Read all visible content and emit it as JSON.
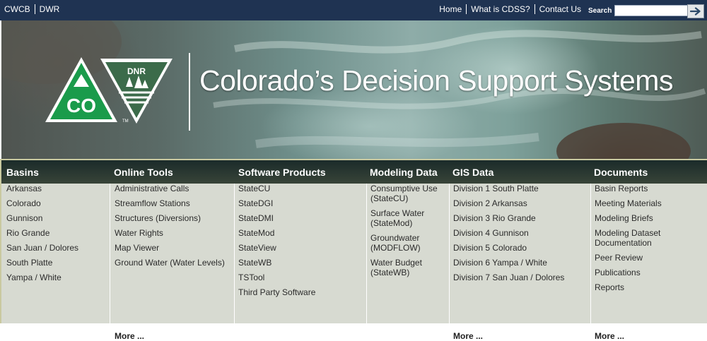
{
  "top_nav": {
    "left_links": [
      "CWCB",
      "DWR"
    ],
    "right_links": [
      "Home",
      "What is CDSS?",
      "Contact Us"
    ],
    "search_label": "Search",
    "search_value": ""
  },
  "banner": {
    "co_logo_text": "CO",
    "dnr_logo_text": "DNR",
    "tm_text": "TM",
    "title": "Colorado’s Decision Support Systems"
  },
  "menu": {
    "columns": [
      {
        "title": "Basins",
        "items": [
          "Arkansas",
          "Colorado",
          "Gunnison",
          "Rio Grande",
          "San Juan / Dolores",
          "South Platte",
          "Yampa / White"
        ],
        "more": ""
      },
      {
        "title": "Online Tools",
        "items": [
          "Administrative Calls",
          "Streamflow Stations",
          "Structures (Diversions)",
          "Water Rights",
          "Map Viewer",
          "Ground Water (Water Levels)"
        ],
        "more": "More ..."
      },
      {
        "title": "Software Products",
        "items": [
          "StateCU",
          "StateDGI",
          "StateDMI",
          "StateMod",
          "StateView",
          "StateWB",
          "TSTool",
          "Third Party Software"
        ],
        "more": ""
      },
      {
        "title": "Modeling Data",
        "items": [
          "Consumptive Use (StateCU)",
          "Surface Water (StateMod)",
          "Groundwater (MODFLOW)",
          "Water Budget (StateWB)"
        ],
        "more": ""
      },
      {
        "title": "GIS Data",
        "items": [
          "Division 1 South Platte",
          "Division 2 Arkansas",
          "Division 3 Rio Grande",
          "Division 4 Gunnison",
          "Division 5 Colorado",
          "Division 6 Yampa / White",
          "Division 7 San Juan / Dolores"
        ],
        "more": "More ..."
      },
      {
        "title": "Documents",
        "items": [
          "Basin Reports",
          "Meeting Materials",
          "Modeling Briefs",
          "Modeling Dataset Documentation",
          "Peer Review",
          "Publications",
          "Reports"
        ],
        "more": "More ..."
      }
    ]
  },
  "colors": {
    "topbar": "#1f3352",
    "menu_header": "#2a3834",
    "menu_body": "#d7dad1",
    "co_green": "#1a9b4b",
    "dnr_green": "#3b6b4a"
  },
  "icons": [
    "arrow-right-icon",
    "colorado-co-logo",
    "dnr-logo"
  ]
}
